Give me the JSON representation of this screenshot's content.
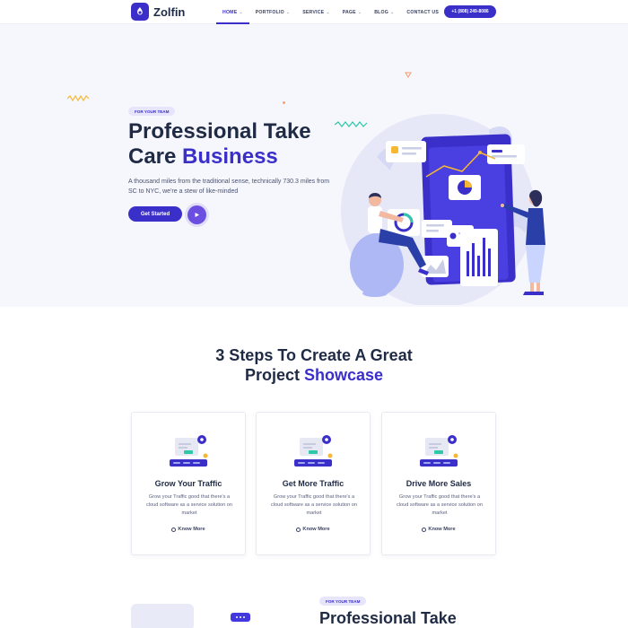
{
  "brand": {
    "name": "Zolfin"
  },
  "nav": {
    "items": [
      {
        "label": "HOME",
        "dropdown": true,
        "active": true
      },
      {
        "label": "PORTFOLIO",
        "dropdown": true,
        "active": false
      },
      {
        "label": "SERVICE",
        "dropdown": true,
        "active": false
      },
      {
        "label": "PAGE",
        "dropdown": true,
        "active": false
      },
      {
        "label": "BLOG",
        "dropdown": true,
        "active": false
      },
      {
        "label": "CONTACT US",
        "dropdown": false,
        "active": false
      }
    ],
    "phone": "+1 (808) 249-8086"
  },
  "hero": {
    "tag": "FOR YOUR TEAM",
    "title_line1": "Professional Take",
    "title_line2_plain": "Care ",
    "title_line2_accent": "Business",
    "description": "A thousand miles from the traditional sense, technically 730.3 miles from SC to NYC, we're a stew of like-minded",
    "cta_label": "Get Started",
    "play_icon": "play-icon"
  },
  "steps": {
    "title_line1": "3 Steps To Create A Great",
    "title_line2_plain": "Project ",
    "title_line2_accent": "Showcase",
    "cards": [
      {
        "title": "Grow Your Traffic",
        "desc": "Grow your Traffic good that there's a cloud software as a service solution on market",
        "link": "Know More"
      },
      {
        "title": "Get More Traffic",
        "desc": "Grow your Traffic good that there's a cloud software as a service solution on market",
        "link": "Know More"
      },
      {
        "title": "Drive More Sales",
        "desc": "Grow your Traffic good that there's a cloud software as a service solution on market",
        "link": "Know More"
      }
    ]
  },
  "section2": {
    "tag": "FOR YOUR TEAM",
    "title": "Professional Take"
  },
  "colors": {
    "primary": "#3b2fc9",
    "hero_bg": "#f6f7fd",
    "heading": "#1f2a44",
    "accent_green": "#2ec7a8",
    "accent_orange": "#f7b733"
  }
}
